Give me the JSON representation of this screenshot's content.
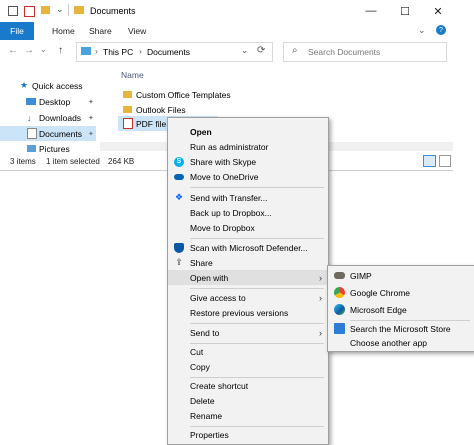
{
  "window": {
    "title": "Documents",
    "tabs": [
      "File",
      "Home",
      "Share",
      "View"
    ],
    "address": [
      "This PC",
      "Documents"
    ],
    "search_placeholder": "Search Documents",
    "column_name": "Name",
    "minimize": "—",
    "maximize": "☐",
    "close": "✕",
    "up": "↑",
    "back": "←",
    "forward": "→",
    "chevron": "⌄"
  },
  "nav": [
    {
      "label": "Quick access",
      "icon": "star-icon"
    },
    {
      "label": "Desktop",
      "icon": "desktop-icon"
    },
    {
      "label": "Downloads",
      "icon": "downloads-icon"
    },
    {
      "label": "Documents",
      "icon": "documents-icon"
    },
    {
      "label": "Pictures",
      "icon": "pictures-icon"
    }
  ],
  "files": [
    {
      "label": "Custom Office Templates"
    },
    {
      "label": "Outlook Files"
    },
    {
      "label": "PDF file"
    }
  ],
  "status": {
    "items": "3 items",
    "selected": "1 item selected",
    "size": "264 KB"
  },
  "context_menu": [
    {
      "label": "Open",
      "bold": true
    },
    {
      "label": "Run as administrator"
    },
    {
      "label": "Share with Skype",
      "icon": "skype-icon"
    },
    {
      "label": "Move to OneDrive",
      "icon": "onedrive-icon"
    },
    {
      "label": "Send with Transfer...",
      "icon": "dropbox-icon"
    },
    {
      "label": "Back up to Dropbox..."
    },
    {
      "label": "Move to Dropbox"
    },
    {
      "label": "Scan with Microsoft Defender...",
      "icon": "defender-icon"
    },
    {
      "label": "Share",
      "icon": "share-icon"
    },
    {
      "label": "Open with"
    },
    {
      "label": "Give access to"
    },
    {
      "label": "Restore previous versions"
    },
    {
      "label": "Send to"
    },
    {
      "label": "Cut"
    },
    {
      "label": "Copy"
    },
    {
      "label": "Create shortcut"
    },
    {
      "label": "Delete"
    },
    {
      "label": "Rename"
    },
    {
      "label": "Properties"
    }
  ],
  "open_with": [
    {
      "label": "GIMP",
      "icon": "gimp-icon"
    },
    {
      "label": "Google Chrome",
      "icon": "chrome-icon"
    },
    {
      "label": "Microsoft Edge",
      "icon": "edge-icon"
    },
    {
      "label": "Search the Microsoft Store",
      "icon": "store-icon"
    },
    {
      "label": "Choose another app"
    }
  ],
  "colors": {
    "accent": "#1979ca",
    "selection": "#cce4f7",
    "menu_bg": "#f2f2f2",
    "folder": "#e8b53c"
  }
}
